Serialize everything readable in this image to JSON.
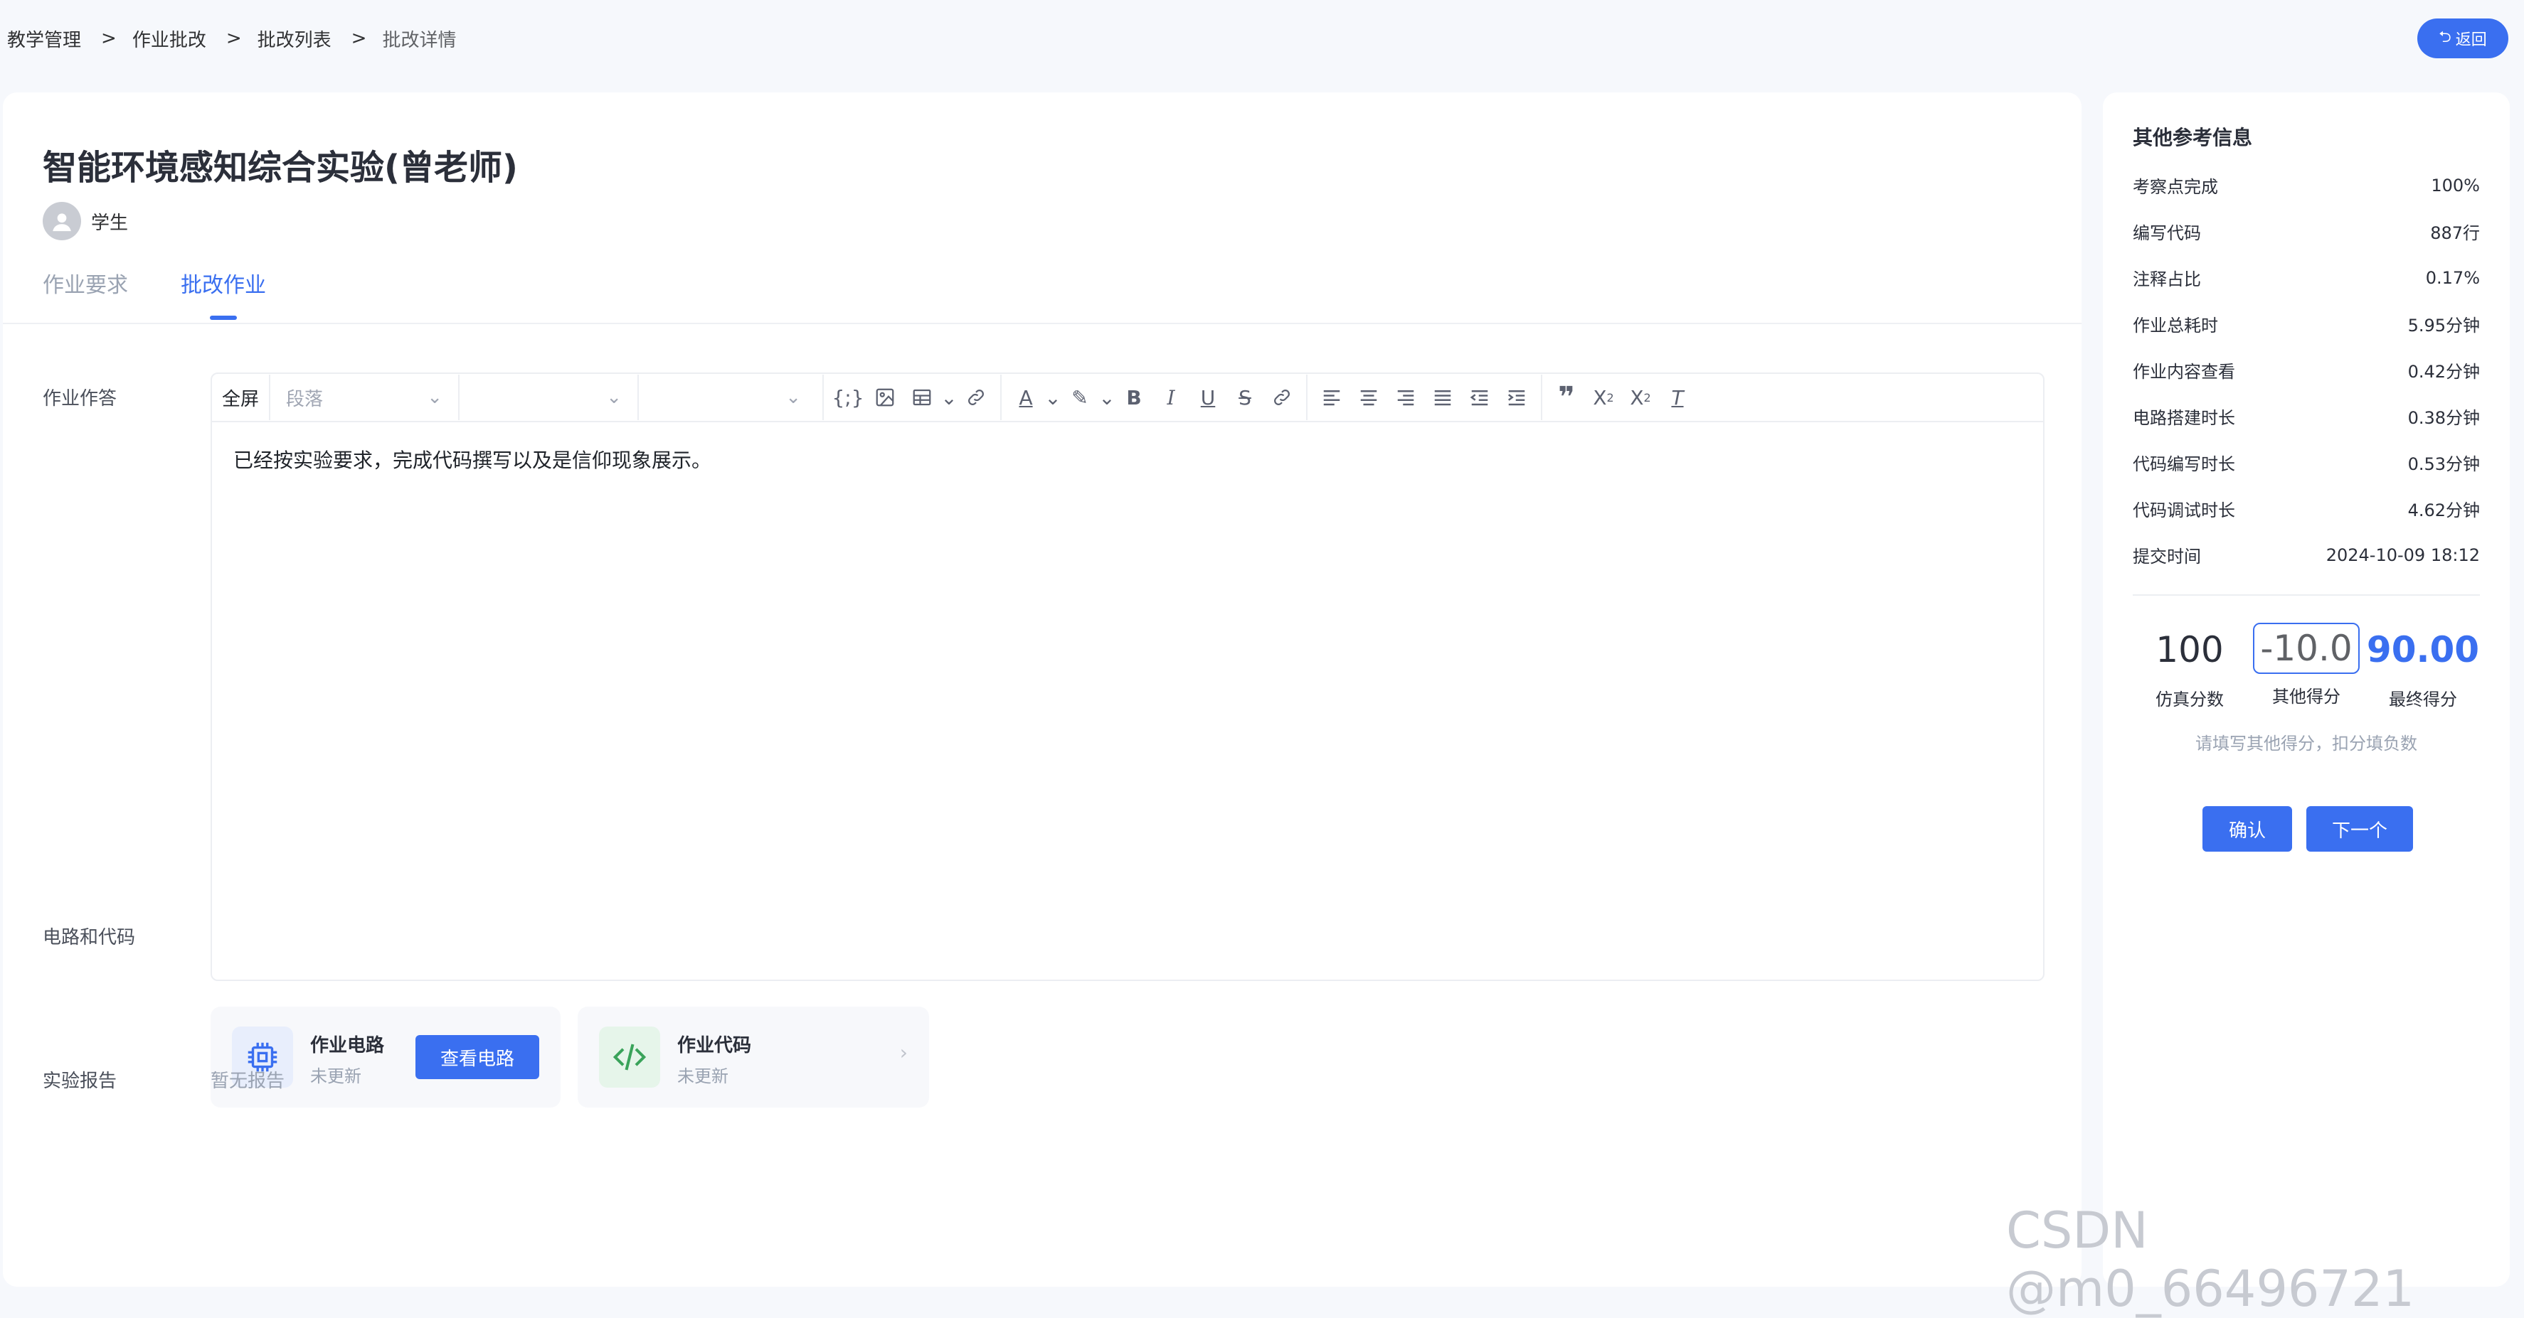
{
  "breadcrumb": {
    "items": [
      "教学管理",
      "作业批改",
      "批改列表",
      "批改详情"
    ],
    "separator": ">"
  },
  "header": {
    "back_label": "返回"
  },
  "assignment": {
    "title": "智能环境感知综合实验(曾老师)",
    "student_label": "学生"
  },
  "tabs": [
    {
      "label": "作业要求",
      "active": false
    },
    {
      "label": "批改作业",
      "active": true
    }
  ],
  "answer": {
    "label": "作业作答",
    "toolbar": {
      "fullscreen_label": "全屏",
      "paragraph_placeholder": "段落",
      "icons": [
        "code-block-icon",
        "image-icon",
        "table-icon",
        "link-icon",
        "font-color-icon",
        "highlight-icon",
        "bold-icon",
        "italic-icon",
        "underline-icon",
        "strikethrough-icon",
        "unlink-icon",
        "align-left-icon",
        "align-center-icon",
        "align-right-icon",
        "align-justify-icon",
        "outdent-icon",
        "indent-icon",
        "blockquote-icon",
        "subscript-icon",
        "superscript-icon",
        "clear-format-icon"
      ]
    },
    "content": "已经按实验要求，完成代码撰写以及是信仰现象展示。"
  },
  "circuit_code": {
    "label": "电路和代码",
    "circuit": {
      "title": "作业电路",
      "status": "未更新",
      "button_label": "查看电路"
    },
    "code": {
      "title": "作业代码",
      "status": "未更新"
    }
  },
  "report": {
    "label": "实验报告",
    "empty_text": "暂无报告"
  },
  "side": {
    "title": "其他参考信息",
    "items": [
      {
        "label": "考察点完成",
        "value": "100%"
      },
      {
        "label": "编写代码",
        "value": "887行"
      },
      {
        "label": "注释占比",
        "value": "0.17%"
      },
      {
        "label": "作业总耗时",
        "value": "5.95分钟"
      },
      {
        "label": "作业内容查看",
        "value": "0.42分钟"
      },
      {
        "label": "电路搭建时长",
        "value": "0.38分钟"
      },
      {
        "label": "代码编写时长",
        "value": "0.53分钟"
      },
      {
        "label": "代码调试时长",
        "value": "4.62分钟"
      },
      {
        "label": "提交时间",
        "value": "2024-10-09 18:12"
      }
    ],
    "scores": {
      "simulation_value": "100",
      "simulation_label": "仿真分数",
      "other_value": "-10.0",
      "other_label": "其他得分",
      "final_value": "90.00",
      "final_label": "最终得分",
      "hint": "请填写其他得分，扣分填负数"
    },
    "confirm_label": "确认",
    "next_label": "下一个"
  },
  "watermark": "CSDN @m0_66496721",
  "colors": {
    "accent": "#3a6ff0",
    "muted": "#9aa3b2"
  }
}
